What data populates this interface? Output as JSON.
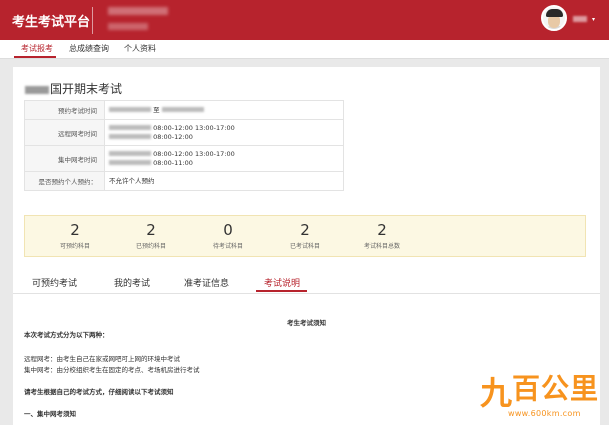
{
  "header": {
    "brand": "考生考试平台",
    "org_name": "",
    "org_sub": "",
    "user_name": "",
    "caret": "▾"
  },
  "nav": {
    "items": [
      "考试报考",
      "总成绩查询",
      "个人资料"
    ],
    "active_index": 0
  },
  "exam": {
    "title_prefix": "",
    "title": "国开期末考试",
    "info_rows": [
      {
        "label": "预约考试时间",
        "lines": [
          {
            "date": "",
            "times": "至"
          }
        ]
      },
      {
        "label": "远程网考时间",
        "lines": [
          {
            "date": "",
            "times": "08:00-12:00 13:00-17:00"
          },
          {
            "date": "",
            "times": "08:00-12:00"
          }
        ]
      },
      {
        "label": "集中网考时间",
        "lines": [
          {
            "date": "",
            "times": "08:00-12:00 13:00-17:00"
          },
          {
            "date": "",
            "times": "08:00-11:00"
          }
        ]
      },
      {
        "label": "是否预约个人预约：",
        "lines": [
          {
            "date": "",
            "times": "不允许个人预约"
          }
        ]
      }
    ]
  },
  "stats": [
    {
      "value": "2",
      "label": "可预约科目"
    },
    {
      "value": "2",
      "label": "已预约科目"
    },
    {
      "value": "0",
      "label": "待考试科目"
    },
    {
      "value": "2",
      "label": "已考试科目"
    },
    {
      "value": "2",
      "label": "考试科目总数"
    }
  ],
  "tabs": {
    "items": [
      "可预约考试",
      "我的考试",
      "准考证信息",
      "考试说明"
    ],
    "active_index": 3
  },
  "notice": {
    "title": "考生考试须知",
    "lines": [
      "本次考试方式分为以下两种：",
      "远程网考：由考生自己在家或网吧可上网的环境中考试",
      "集中网考：由分校组织考生在固定的考点、考场机房进行考试",
      "请考生根据自己的考试方式，仔细阅读以下考试须知",
      "一、集中网考须知"
    ]
  },
  "watermark": {
    "glyphs": [
      "九",
      "百",
      "公",
      "里"
    ],
    "url": "www.600km.com"
  },
  "colors": {
    "brand_red": "#b7232d",
    "stats_bg": "#fcf8e3",
    "watermark": "#f7931e"
  }
}
